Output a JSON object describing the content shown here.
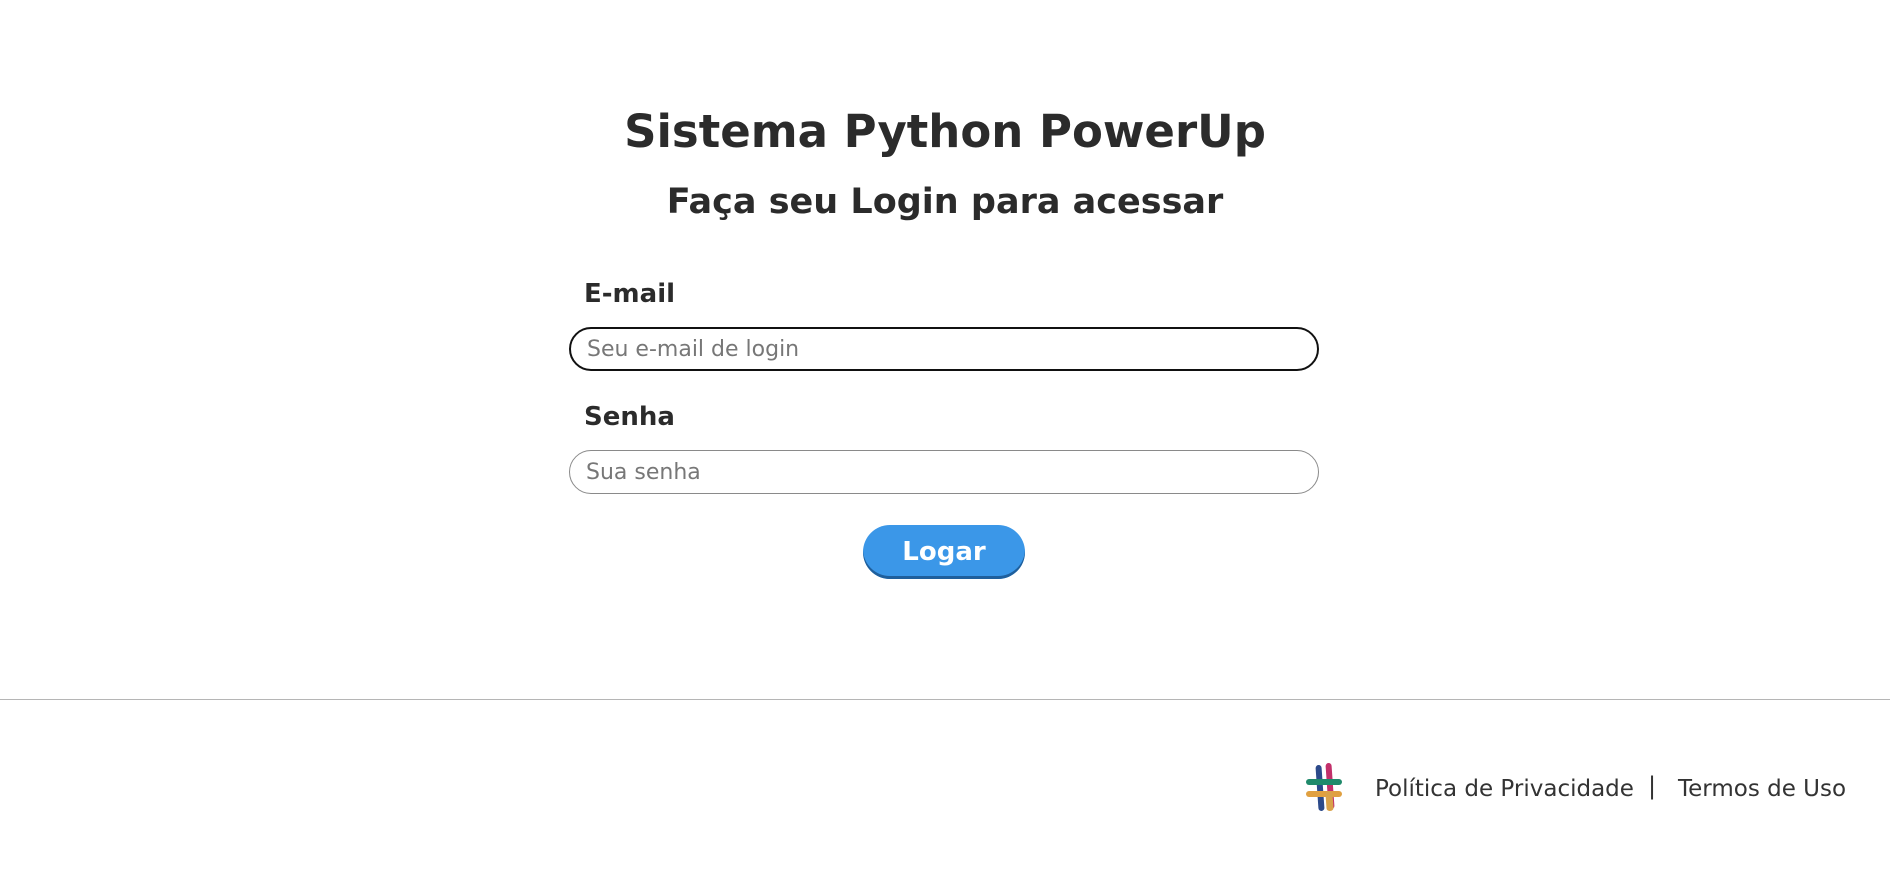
{
  "header": {
    "title": "Sistema Python PowerUp",
    "subtitle": "Faça seu Login para acessar"
  },
  "form": {
    "email_label": "E-mail",
    "email_placeholder": "Seu e-mail de login",
    "email_value": "",
    "password_label": "Senha",
    "password_placeholder": "Sua senha",
    "password_value": "",
    "submit_label": "Logar"
  },
  "footer": {
    "logo_icon": "hashtag-logo-icon",
    "privacy_link": "Política de Privacidade",
    "separator": "|",
    "terms_link": "Termos de Uso"
  },
  "colors": {
    "button": "#3b97e8",
    "text": "#2b2b2b",
    "divider": "#b5b5b5"
  }
}
